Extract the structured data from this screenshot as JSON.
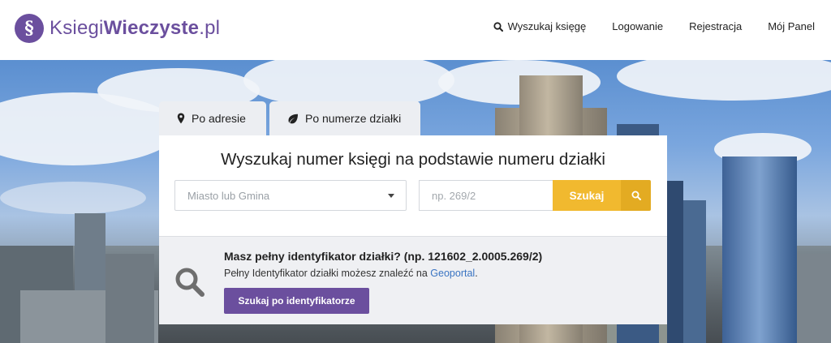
{
  "header": {
    "logo_symbol": "§",
    "logo_text_regular_1": "Ksiegi",
    "logo_text_bold": "Wieczyste",
    "logo_text_regular_2": ".pl",
    "brand_color": "#6b4f9e",
    "nav": {
      "search_label": "Wyszukaj księgę",
      "search_icon": "search-icon",
      "login_label": "Logowanie",
      "register_label": "Rejestracja",
      "panel_label": "Mój Panel"
    }
  },
  "tabs": [
    {
      "label": "Po adresie",
      "icon": "map-pin-icon"
    },
    {
      "label": "Po numerze działki",
      "icon": "leaf-icon"
    }
  ],
  "search_card": {
    "title": "Wyszukaj numer księgi na podstawie numeru działki",
    "city_select_placeholder": "Miasto lub Gmina",
    "plot_input_placeholder": "np. 269/2",
    "plot_input_value": "",
    "search_button_label": "Szukaj",
    "accent_color": "#f1b92f"
  },
  "identifier_panel": {
    "title": "Masz pełny identyfikator działki? (np. 121602_2.0005.269/2)",
    "text_before_link": "Pełny Identyfikator działki możesz znaleźć na ",
    "link_label": "Geoportal",
    "text_after_link": ".",
    "button_label": "Szukaj po identyfikatorze"
  }
}
